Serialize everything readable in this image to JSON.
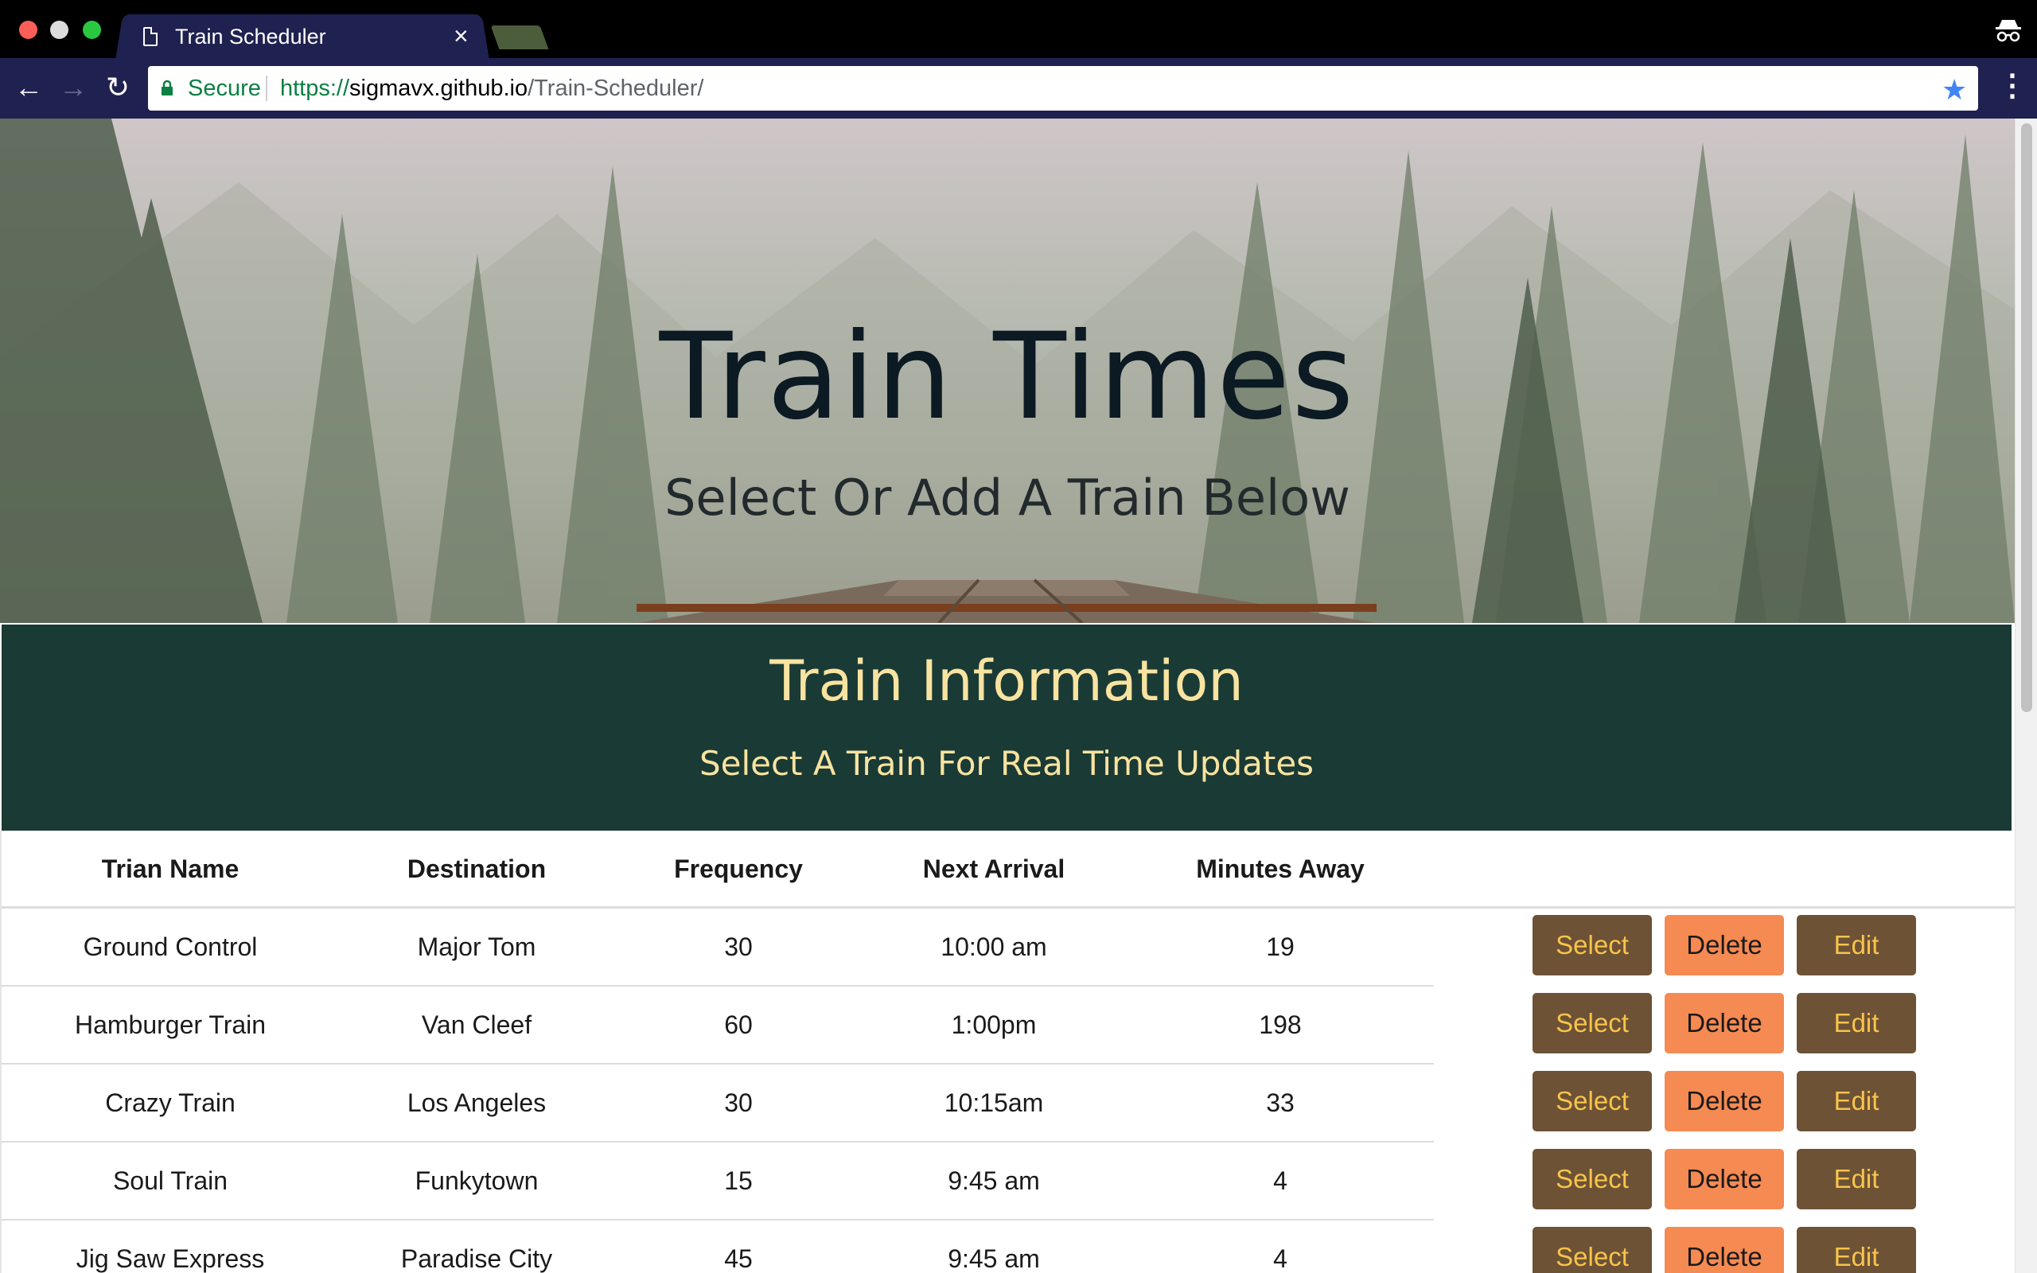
{
  "browser": {
    "tab_title": "Train Scheduler",
    "tab_close": "×",
    "secure_label": "Secure",
    "url_scheme": "https://",
    "url_host": "sigmavx.github.io",
    "url_path": "/Train-Scheduler/",
    "back": "←",
    "forward": "→",
    "reload": "↻",
    "star": "★",
    "menu": "⋮"
  },
  "hero": {
    "title": "Train Times",
    "subtitle": "Select Or Add A Train Below"
  },
  "info": {
    "title": "Train Information",
    "subtitle": "Select A Train For Real Time Updates"
  },
  "table": {
    "headers": [
      "Trian Name",
      "Destination",
      "Frequency",
      "Next Arrival",
      "Minutes Away"
    ],
    "rows": [
      [
        "Ground Control",
        "Major Tom",
        "30",
        "10:00 am",
        "19"
      ],
      [
        "Hamburger Train",
        "Van Cleef",
        "60",
        "1:00pm",
        "198"
      ],
      [
        "Crazy Train",
        "Los Angeles",
        "30",
        "10:15am",
        "33"
      ],
      [
        "Soul Train",
        "Funkytown",
        "15",
        "9:45 am",
        "4"
      ],
      [
        "Jig Saw Express",
        "Paradise City",
        "45",
        "9:45 am",
        "4"
      ]
    ],
    "actions": {
      "select": "Select",
      "delete": "Delete",
      "edit": "Edit"
    }
  },
  "colors": {
    "panel": "#1a3a35",
    "panel_text": "#f8e3a0",
    "select_button": "#6d5235",
    "delete_button": "#f58a52"
  }
}
